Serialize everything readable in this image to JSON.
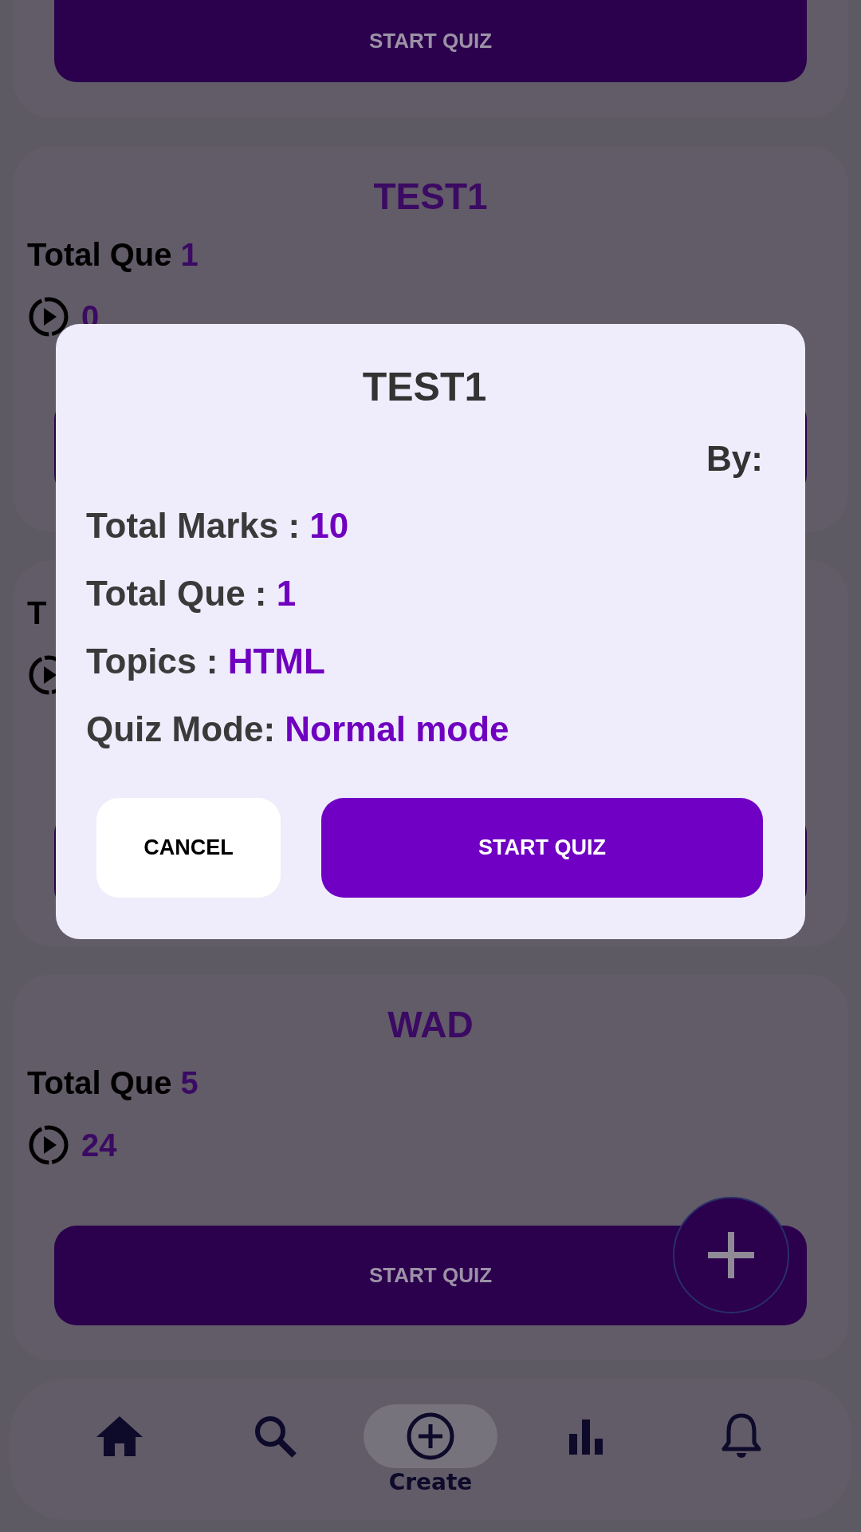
{
  "quiz_cards": [
    {
      "button": "START QUIZ"
    },
    {
      "title": "TEST1",
      "total_label": "Total Que",
      "total_value": "1",
      "plays": "0"
    },
    {
      "total_label": "T"
    },
    {
      "title": "WAD",
      "total_label": "Total Que",
      "total_value": "5",
      "plays": "24",
      "button": "START QUIZ"
    }
  ],
  "dialog": {
    "title": "TEST1",
    "author_label": "By:",
    "details": [
      {
        "label": "Total Marks :",
        "value": "10"
      },
      {
        "label": "Total Que :",
        "value": "1"
      },
      {
        "label": "Topics :",
        "value": "HTML"
      },
      {
        "label": "Quiz Mode:",
        "value": "Normal mode"
      }
    ],
    "buttons": [
      {
        "kind": "secondary",
        "label": "CANCEL"
      },
      {
        "kind": "primary",
        "label": "START QUIZ"
      }
    ]
  },
  "bottom_nav": [
    {
      "kind": "home",
      "selected": false
    },
    {
      "kind": "search",
      "selected": false
    },
    {
      "kind": "create",
      "label": "Create",
      "selected": true
    },
    {
      "kind": "chart",
      "selected": false
    },
    {
      "kind": "bell",
      "selected": false
    }
  ]
}
